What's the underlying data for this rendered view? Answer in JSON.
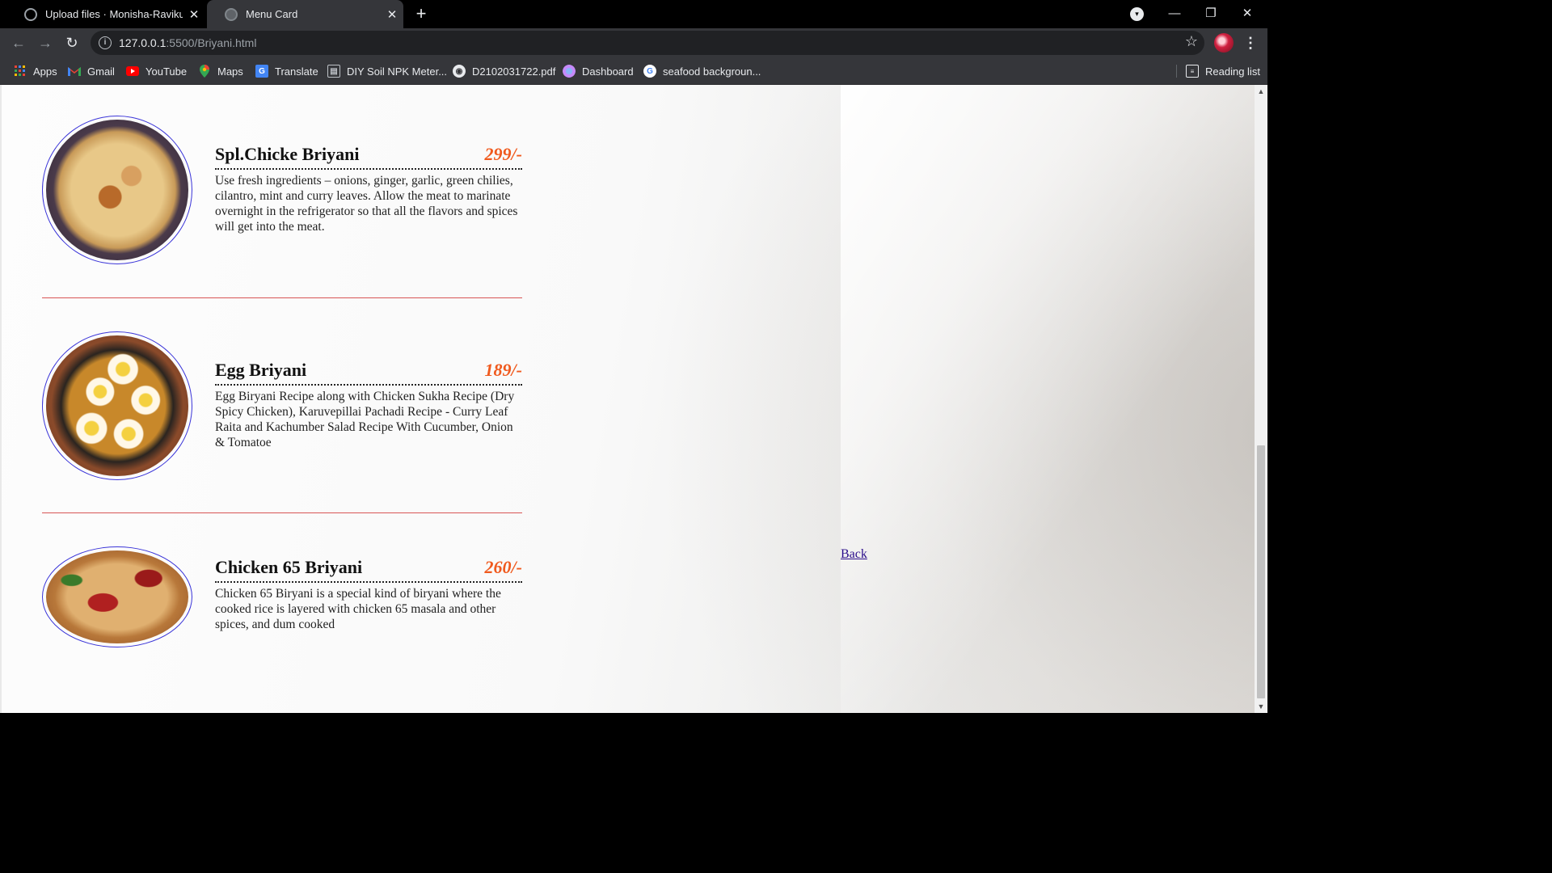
{
  "browser": {
    "tabs": [
      {
        "title": "Upload files · Monisha-Ravikumar",
        "close": "✕"
      },
      {
        "title": "Menu Card",
        "close": "✕"
      }
    ],
    "new_tab": "+",
    "url_host": "127.0.0.1",
    "url_path": ":5500/Briyani.html",
    "window_controls": {
      "minimize": "—",
      "restore": "❐",
      "close": "✕"
    },
    "bookmarks": [
      {
        "label": "Apps",
        "icon": "apps-grid-icon"
      },
      {
        "label": "Gmail",
        "icon": "gmail-icon"
      },
      {
        "label": "YouTube",
        "icon": "youtube-icon"
      },
      {
        "label": "Maps",
        "icon": "maps-pin-icon"
      },
      {
        "label": "Translate",
        "icon": "translate-icon"
      },
      {
        "label": "DIY Soil NPK Meter...",
        "icon": "page-icon"
      },
      {
        "label": "D2102031722.pdf",
        "icon": "globe-icon"
      },
      {
        "label": "Dashboard",
        "icon": "dashboard-icon"
      },
      {
        "label": "seafood backgroun...",
        "icon": "google-icon"
      }
    ],
    "reading_list": "Reading list"
  },
  "menu": [
    {
      "name": "Spl.Chicke Briyani",
      "price": "299/-",
      "description": "Use fresh ingredients – onions, ginger, garlic, green chilies, cilantro, mint and curry leaves. Allow the meat to marinate overnight in the refrigerator so that all the flavors and spices will get into the meat."
    },
    {
      "name": "Egg Briyani",
      "price": "189/-",
      "description": "Egg Biryani Recipe along with Chicken Sukha Recipe (Dry Spicy Chicken), Karuvepillai Pachadi Recipe - Curry Leaf Raita and Kachumber Salad Recipe With Cucumber, Onion & Tomatoe"
    },
    {
      "name": "Chicken 65 Briyani",
      "price": "260/-",
      "description": "Chicken 65 Biryani is a special kind of biryani where the cooked rice is layered with chicken 65 masala and other spices, and dum cooked"
    }
  ],
  "back_link": "Back",
  "colors": {
    "price": "#f05a1e",
    "divider": "#d85555",
    "image_border": "#3a34d8",
    "link": "#2a0c8a"
  }
}
